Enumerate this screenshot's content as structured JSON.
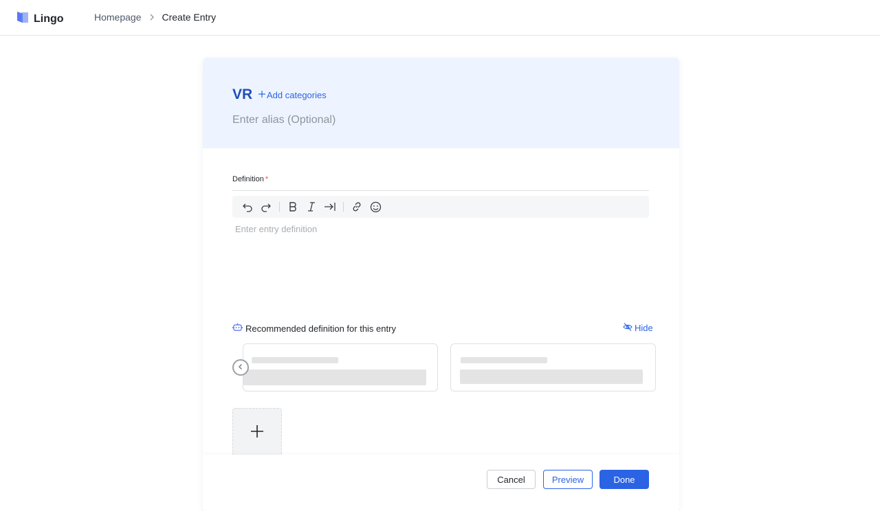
{
  "app": {
    "name": "Lingo",
    "logo_icon": "lingo-logo-icon",
    "accent": "#2b63e5"
  },
  "breadcrumb": {
    "home": "Homepage",
    "current": "Create Entry"
  },
  "entry": {
    "term": "VR",
    "add_categories": "Add categories",
    "alias_placeholder": "Enter alias (Optional)",
    "alias_value": ""
  },
  "definition": {
    "label": "Definition",
    "required_mark": "*",
    "placeholder": "Enter entry definition",
    "toolbar": [
      "undo-icon",
      "redo-icon",
      "bold-icon",
      "italic-icon",
      "indent-icon",
      "link-icon",
      "emoji-icon"
    ]
  },
  "recommended": {
    "title": "Recommended definition for this entry",
    "hide_label": "Hide"
  },
  "footer": {
    "cancel": "Cancel",
    "preview": "Preview",
    "done": "Done"
  }
}
